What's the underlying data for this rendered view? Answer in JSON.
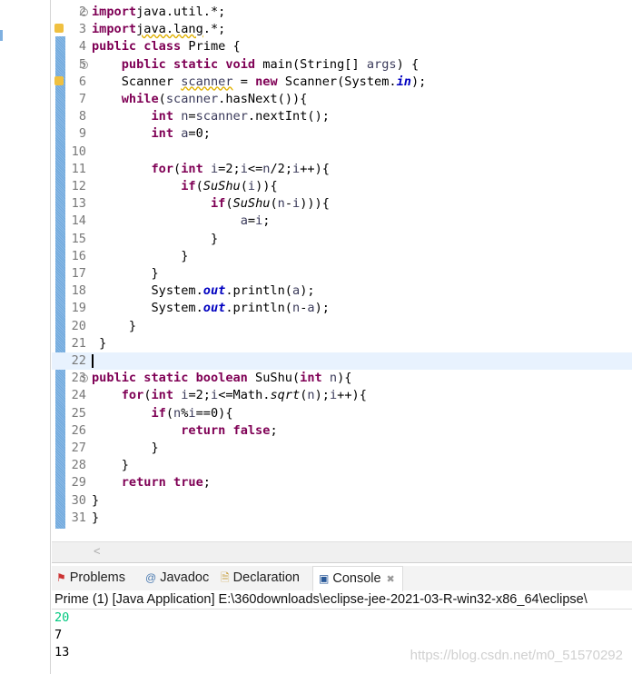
{
  "editor": {
    "current_line": 22,
    "lines": [
      {
        "n": "2",
        "fold": true,
        "segs": [
          [
            "kw",
            "import"
          ],
          [
            "",
            "java.util.*;"
          ]
        ]
      },
      {
        "n": "3",
        "warn": true,
        "segs": [
          [
            "kw",
            "import"
          ],
          [
            "sq",
            "java.lang"
          ],
          [
            "",
            ".*;"
          ]
        ]
      },
      {
        "n": "4",
        "segs": [
          [
            "kw",
            "public class"
          ],
          [
            "",
            " Prime {"
          ]
        ]
      },
      {
        "n": "5",
        "fold": true,
        "segs": [
          [
            "",
            "    "
          ],
          [
            "kw",
            "public static void"
          ],
          [
            "",
            " main(String[] "
          ],
          [
            "var",
            "args"
          ],
          [
            "",
            ") {"
          ]
        ]
      },
      {
        "n": "6",
        "warn": true,
        "segs": [
          [
            "",
            "    Scanner "
          ],
          [
            "sq var",
            "scanner"
          ],
          [
            "",
            " = "
          ],
          [
            "kw",
            "new"
          ],
          [
            "",
            " Scanner(System."
          ],
          [
            "fld",
            "in"
          ],
          [
            "",
            ");"
          ]
        ]
      },
      {
        "n": "7",
        "segs": [
          [
            "",
            "    "
          ],
          [
            "kw",
            "while"
          ],
          [
            "",
            "("
          ],
          [
            "var",
            "scanner"
          ],
          [
            "",
            ".hasNext()){"
          ]
        ]
      },
      {
        "n": "8",
        "segs": [
          [
            "",
            "        "
          ],
          [
            "kw",
            "int"
          ],
          [
            " var",
            " n"
          ],
          [
            "",
            "="
          ],
          [
            "var",
            "scanner"
          ],
          [
            "",
            ".nextInt();"
          ]
        ]
      },
      {
        "n": "9",
        "segs": [
          [
            "",
            "        "
          ],
          [
            "kw",
            "int"
          ],
          [
            "var",
            " a"
          ],
          [
            "",
            "=0;"
          ]
        ]
      },
      {
        "n": "10",
        "segs": []
      },
      {
        "n": "11",
        "segs": [
          [
            "",
            "        "
          ],
          [
            "kw",
            "for"
          ],
          [
            "",
            "("
          ],
          [
            "kw",
            "int"
          ],
          [
            "var",
            " i"
          ],
          [
            "",
            "=2;"
          ],
          [
            "var",
            "i"
          ],
          [
            "",
            "<="
          ],
          [
            "var",
            "n"
          ],
          [
            "",
            "/2;"
          ],
          [
            "var",
            "i"
          ],
          [
            "",
            "++){"
          ]
        ]
      },
      {
        "n": "12",
        "segs": [
          [
            "",
            "            "
          ],
          [
            "kw",
            "if"
          ],
          [
            "",
            "("
          ],
          [
            "it",
            "SuShu"
          ],
          [
            "",
            "("
          ],
          [
            "var",
            "i"
          ],
          [
            "",
            ")){"
          ]
        ]
      },
      {
        "n": "13",
        "segs": [
          [
            "",
            "                "
          ],
          [
            "kw",
            "if"
          ],
          [
            "",
            "("
          ],
          [
            "it",
            "SuShu"
          ],
          [
            "",
            "("
          ],
          [
            "var",
            "n"
          ],
          [
            "",
            "-"
          ],
          [
            "var",
            "i"
          ],
          [
            "",
            "))){"
          ]
        ]
      },
      {
        "n": "14",
        "segs": [
          [
            "",
            "                    "
          ],
          [
            "var",
            "a"
          ],
          [
            "",
            "="
          ],
          [
            "var",
            "i"
          ],
          [
            "",
            ";"
          ]
        ]
      },
      {
        "n": "15",
        "segs": [
          [
            "",
            "                }"
          ]
        ]
      },
      {
        "n": "16",
        "segs": [
          [
            "",
            "            }"
          ]
        ]
      },
      {
        "n": "17",
        "segs": [
          [
            "",
            "        }"
          ]
        ]
      },
      {
        "n": "18",
        "segs": [
          [
            "",
            "        System."
          ],
          [
            "fld",
            "out"
          ],
          [
            "",
            ".println("
          ],
          [
            "var",
            "a"
          ],
          [
            "",
            ");"
          ]
        ]
      },
      {
        "n": "19",
        "segs": [
          [
            "",
            "        System."
          ],
          [
            "fld",
            "out"
          ],
          [
            "",
            ".println("
          ],
          [
            "var",
            "n"
          ],
          [
            "",
            "-"
          ],
          [
            "var",
            "a"
          ],
          [
            "",
            ");"
          ]
        ]
      },
      {
        "n": "20",
        "segs": [
          [
            "",
            "     }"
          ]
        ]
      },
      {
        "n": "21",
        "segs": [
          [
            "",
            " }"
          ]
        ]
      },
      {
        "n": "22",
        "segs": []
      },
      {
        "n": "23",
        "fold": true,
        "segs": [
          [
            "kw",
            "public static boolean"
          ],
          [
            "",
            " SuShu("
          ],
          [
            "kw",
            "int"
          ],
          [
            "var",
            " n"
          ],
          [
            "",
            "){"
          ]
        ]
      },
      {
        "n": "24",
        "segs": [
          [
            "",
            "    "
          ],
          [
            "kw",
            "for"
          ],
          [
            "",
            "("
          ],
          [
            "kw",
            "int"
          ],
          [
            "var",
            " i"
          ],
          [
            "",
            "=2;"
          ],
          [
            "var",
            "i"
          ],
          [
            "",
            "<=Math."
          ],
          [
            "it",
            "sqrt"
          ],
          [
            "",
            "("
          ],
          [
            "var",
            "n"
          ],
          [
            "",
            ");"
          ],
          [
            "var",
            "i"
          ],
          [
            "",
            "++){"
          ]
        ]
      },
      {
        "n": "25",
        "segs": [
          [
            "",
            "        "
          ],
          [
            "kw",
            "if"
          ],
          [
            "",
            "("
          ],
          [
            "var",
            "n"
          ],
          [
            "",
            "%"
          ],
          [
            "var",
            "i"
          ],
          [
            "",
            "==0){"
          ]
        ]
      },
      {
        "n": "26",
        "segs": [
          [
            "",
            "            "
          ],
          [
            "kw",
            "return false"
          ],
          [
            "",
            ";"
          ]
        ]
      },
      {
        "n": "27",
        "segs": [
          [
            "",
            "        }"
          ]
        ]
      },
      {
        "n": "28",
        "segs": [
          [
            "",
            "    }"
          ]
        ]
      },
      {
        "n": "29",
        "segs": [
          [
            "",
            "    "
          ],
          [
            "kw",
            "return true"
          ],
          [
            "",
            ";"
          ]
        ]
      },
      {
        "n": "30",
        "segs": [
          [
            "",
            "}"
          ]
        ]
      },
      {
        "n": "31",
        "segs": [
          [
            "",
            "}"
          ]
        ]
      }
    ]
  },
  "tabs": {
    "problems": "Problems",
    "javadoc": "Javadoc",
    "declaration": "Declaration",
    "console": "Console",
    "javadoc_icon": "@"
  },
  "console": {
    "title": "Prime (1) [Java Application] E:\\360downloads\\eclipse-jee-2021-03-R-win32-x86_64\\eclipse\\",
    "input_color": "#00c87f",
    "output": [
      "20",
      "7",
      "13"
    ]
  },
  "watermark": "https://blog.csdn.net/m0_51570292"
}
